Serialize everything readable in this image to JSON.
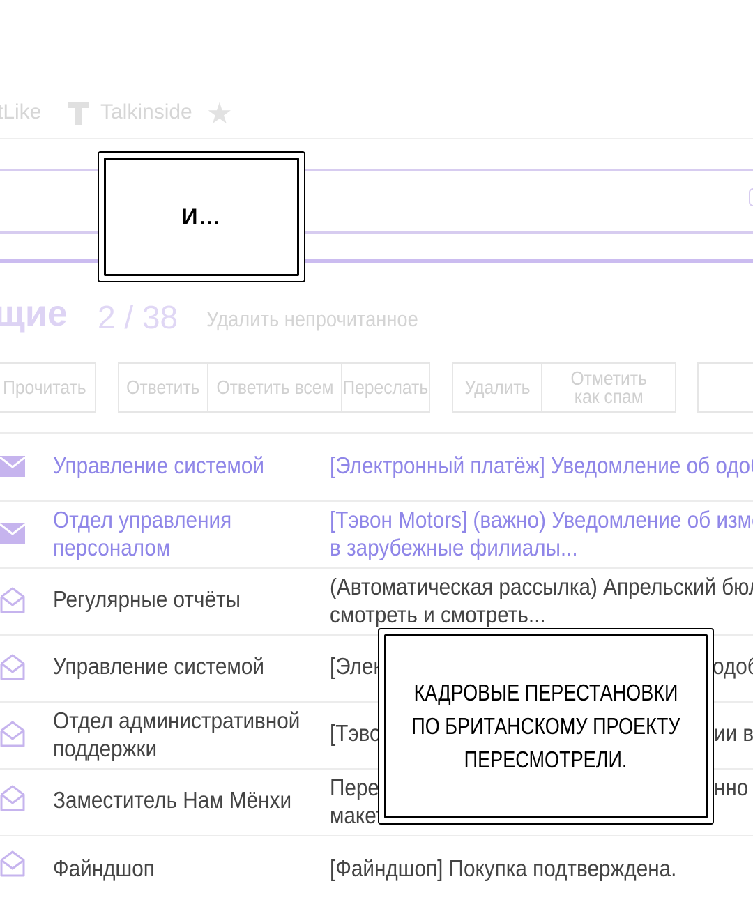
{
  "bookmarks": {
    "item1": "tLike",
    "item2": "Talkinside"
  },
  "panel_top": "И…",
  "panel_bottom": [
    "КАДРОВЫЕ ПЕРЕСТАНОВКИ",
    "ПО БРИТАНСКОМУ ПРОЕКТУ",
    "ПЕРЕСМОТРЕЛИ."
  ],
  "folder": {
    "name": "щие",
    "count": "2 / 38",
    "delete_unread": "Удалить непрочитанное"
  },
  "toolbar": {
    "read": "Прочитать",
    "reply": "Ответить",
    "reply_all": "Ответить всем",
    "forward": "Переслать",
    "delete": "Удалить",
    "mark_spam_1": "Отметить",
    "mark_spam_2": "как спам"
  },
  "rows": [
    {
      "state": "unread",
      "sender": [
        "Управление системой"
      ],
      "subject": [
        "[Электронный платёж] Уведомление об одоб"
      ]
    },
    {
      "state": "unread",
      "sender": [
        "Отдел управления",
        "персоналом"
      ],
      "subject": [
        "[Тэвон Motors] (важно) Уведомление об изме",
        "в зарубежные филиалы..."
      ]
    },
    {
      "state": "read",
      "sender": [
        "Регулярные отчёты"
      ],
      "subject": [
        "(Автоматическая рассылка) Апрельский бюл",
        "смотреть и смотреть..."
      ]
    },
    {
      "state": "read",
      "sender": [
        "Управление системой"
      ],
      "subject": [
        "[Элек",
        "одоб"
      ]
    },
    {
      "state": "read",
      "sender": [
        "Отдел административной",
        "поддержки"
      ],
      "subject": [
        "[Тэво",
        "ии в"
      ]
    },
    {
      "state": "read",
      "sender": [
        "Заместитель Нам Мёнхи"
      ],
      "subject": [
        "Пере",
        "макет",
        "нно"
      ]
    },
    {
      "state": "read",
      "sender": [
        "Файндшоп"
      ],
      "subject": [
        "[Файндшоп] Покупка подтверждена."
      ]
    }
  ],
  "colors": {
    "accent": "#8f86e8",
    "envelope": "#c6b4ee",
    "search_border": "#d7ccf0"
  }
}
